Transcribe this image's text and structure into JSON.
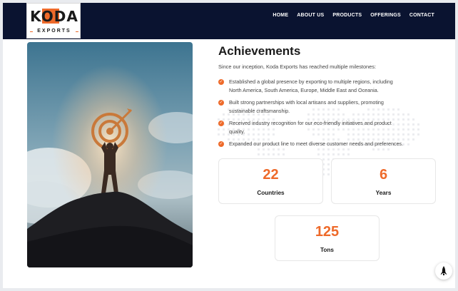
{
  "brand": {
    "logo_text": "KODA",
    "logo_subtext": "EXPORTS",
    "accent_color": "#ee6a2a",
    "navbar_color": "#0a1330"
  },
  "nav": {
    "items": [
      "HOME",
      "ABOUT US",
      "PRODUCTS",
      "OFFERINGS",
      "CONTACT"
    ]
  },
  "hero_image": {
    "icon": "person-holding-target-on-mountain-silhouette"
  },
  "achievements": {
    "title": "Achievements",
    "intro": "Since our inception, Koda Exports has reached multiple milestones:",
    "items": [
      [
        "Established a global presence by exporting to multiple regions, including",
        "North America, South America, Europe, Middle East and Oceania."
      ],
      [
        "Built strong partnerships with local artisans and suppliers, promoting",
        "sustainable craftsmanship."
      ],
      [
        "Received industry recognition for our eco-friendly initiatives and product",
        "quality."
      ],
      [
        "Expanded our product line to meet diverse customer needs and preferences."
      ]
    ],
    "check_icon": "check-circle-icon"
  },
  "stats": [
    {
      "value": "22",
      "label": "Countries"
    },
    {
      "value": "6",
      "label": "Years"
    },
    {
      "value": "125",
      "label": "Tons"
    }
  ],
  "scroll_top": {
    "icon": "rocket-icon"
  }
}
